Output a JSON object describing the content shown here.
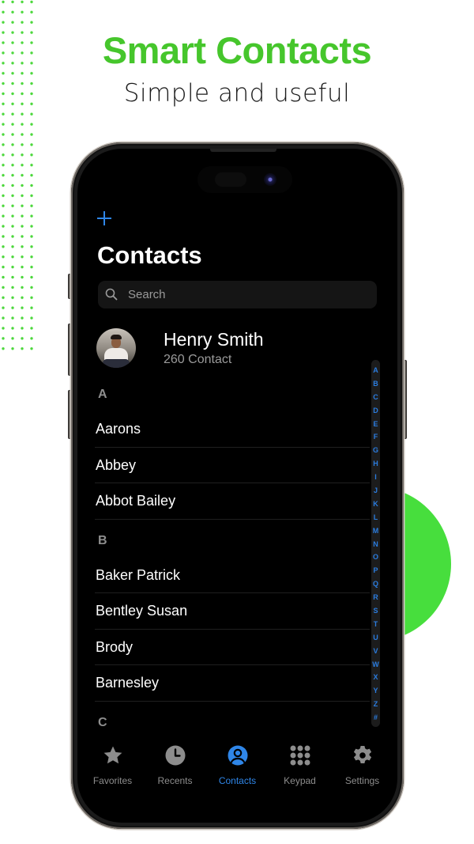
{
  "promo": {
    "title": "Smart Contacts",
    "subtitle": "Simple and useful",
    "accent_color": "#46c62c"
  },
  "app": {
    "add_icon": "plus-icon",
    "title": "Contacts",
    "search": {
      "placeholder": "Search",
      "value": "",
      "icon": "search-icon"
    },
    "profile": {
      "name": "Henry Smith",
      "subtitle": "260 Contact"
    },
    "sections": [
      {
        "letter": "A",
        "contacts": [
          "Aarons",
          "Abbey",
          "Abbot Bailey"
        ]
      },
      {
        "letter": "B",
        "contacts": [
          "Baker Patrick",
          "Bentley Susan",
          "Brody",
          "Barnesley"
        ]
      },
      {
        "letter": "C",
        "contacts": []
      }
    ],
    "index_letters": [
      "A",
      "B",
      "C",
      "D",
      "E",
      "F",
      "G",
      "H",
      "I",
      "J",
      "K",
      "L",
      "M",
      "N",
      "O",
      "P",
      "Q",
      "R",
      "S",
      "T",
      "U",
      "V",
      "W",
      "X",
      "Y",
      "Z",
      "#"
    ],
    "tabs": [
      {
        "label": "Favorites",
        "icon": "star-icon",
        "active": false
      },
      {
        "label": "Recents",
        "icon": "clock-icon",
        "active": false
      },
      {
        "label": "Contacts",
        "icon": "person-circle-icon",
        "active": true
      },
      {
        "label": "Keypad",
        "icon": "keypad-icon",
        "active": false
      },
      {
        "label": "Settings",
        "icon": "gear-icon",
        "active": false
      }
    ],
    "colors": {
      "accent": "#2f86e8",
      "inactive": "#8d8d8d",
      "background": "#000000"
    }
  }
}
